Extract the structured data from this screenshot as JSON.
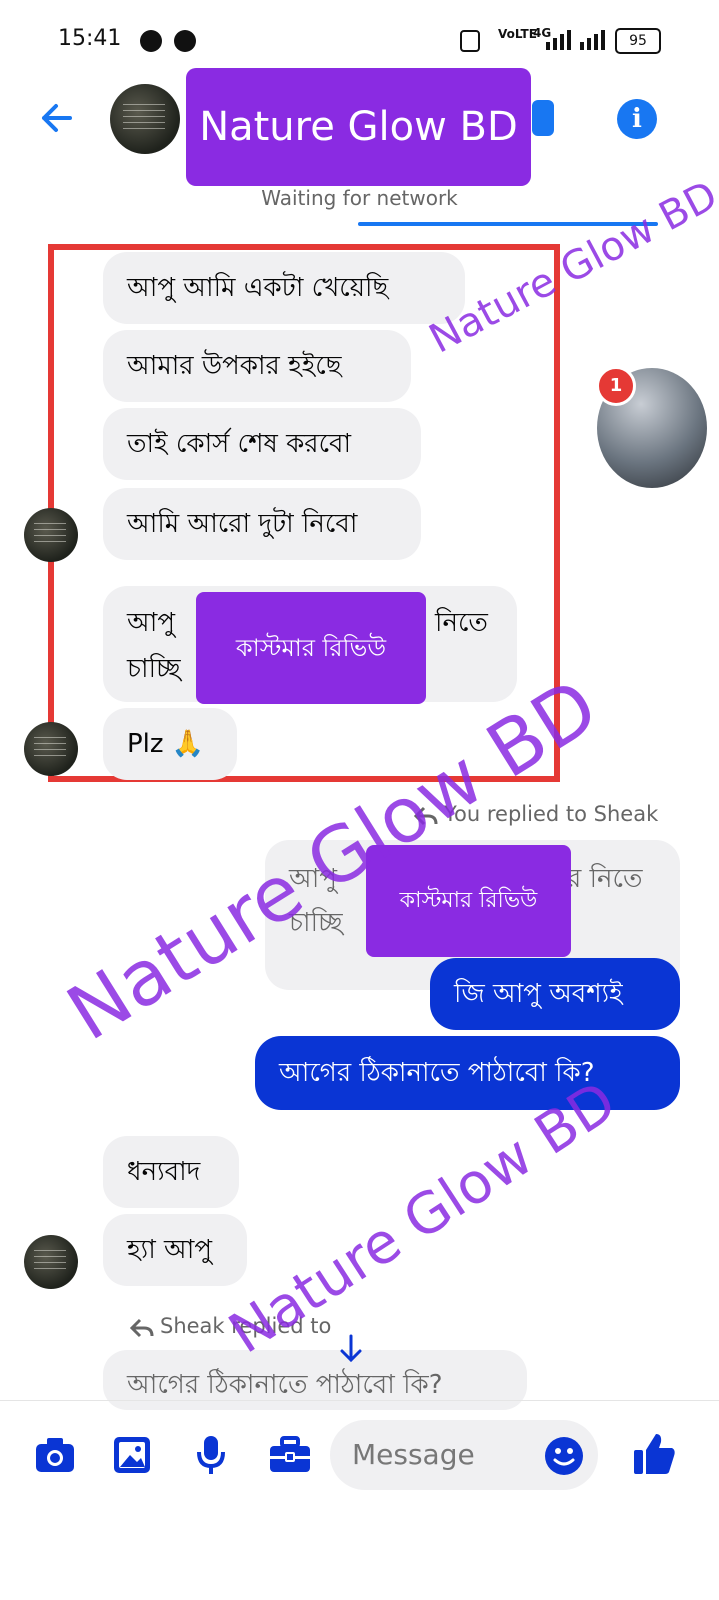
{
  "status_bar": {
    "time": "15:41",
    "battery": "95",
    "network": "4G"
  },
  "header": {
    "title": "Nature Glow BD",
    "status": "Waiting for network"
  },
  "messages": {
    "m1": "আপু আমি একটা খেয়েছি",
    "m2": "আমার উপকার হইছে",
    "m3": "তাই কোর্স শেষ করবো",
    "m4": "আমি আরো দুটা নিবো",
    "m5_line1": "আপু",
    "m5_tail1": "নিতে",
    "m5_line2": "চাচ্ছি",
    "m6": "Plz 🙏",
    "reply_note_1": "You replied to Sheak",
    "quoted_line1": "আপু",
    "quoted_tail": "র নিতে",
    "quoted_line2": "চাচ্ছি",
    "out1": "জি আপু অবশ্যই",
    "out2": "আগের ঠিকানাতে পাঠাবো কি?",
    "m7": "ধন্যবাদ",
    "m8": "হ্যা আপু",
    "reply_note_2": "Sheak replied to",
    "quoted_bottom": "আগের ঠিকানাতে পাঠাবো কি?"
  },
  "overlays": {
    "label_1": "কাস্টমার রিভিউ",
    "label_2": "কাস্টমার রিভিউ",
    "watermark": "Nature Glow BD",
    "badge_count": "1"
  },
  "composer": {
    "placeholder": "Message"
  },
  "colors": {
    "accent": "#0a35d4",
    "messenger_blue": "#1877f2",
    "watermark": "#8a2be2",
    "frame": "#e53935"
  }
}
